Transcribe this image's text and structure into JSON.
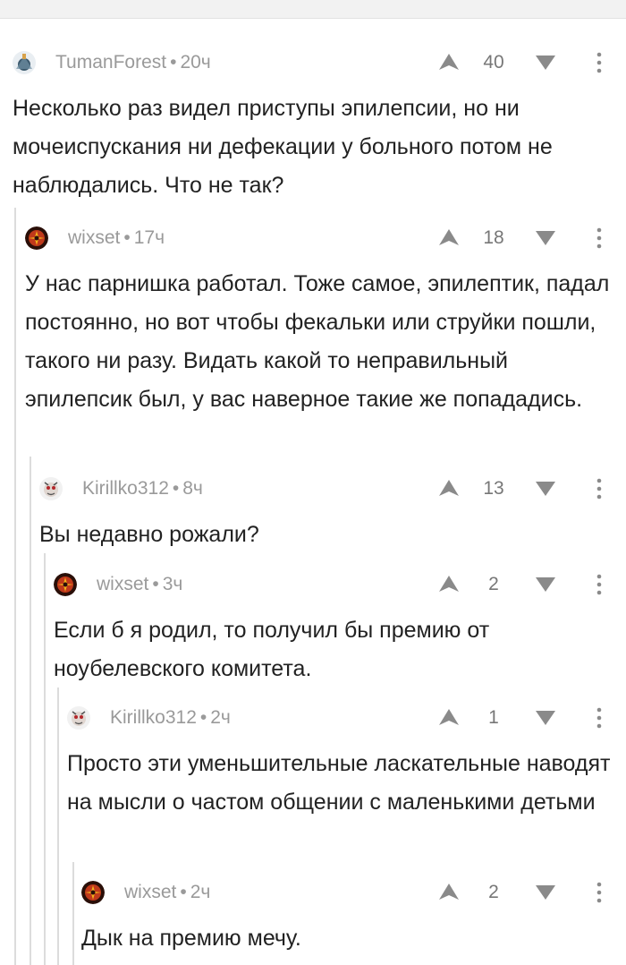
{
  "comments": [
    {
      "author": "TumanForest",
      "time": "20ч",
      "score": "40",
      "text": "Несколько раз видел приступы эпилепсии, но ни мочеиспускания ни дефекации у больного потом не наблюдались. Что не так?",
      "avatar": "tumanforest-avatar"
    },
    {
      "author": "wixset",
      "time": "17ч",
      "score": "18",
      "text": "У нас парнишка работал. Тоже самое, эпилептик, падал постоянно, но вот чтобы фекальки или струйки пошли, такого ни разу. Видать какой то неправильный эпилепсик был, у вас наверное такие же попададись.",
      "avatar": "wixset-avatar"
    },
    {
      "author": "Kirillko312",
      "time": "8ч",
      "score": "13",
      "text": "Вы недавно рожали?",
      "avatar": "kirillko312-avatar"
    },
    {
      "author": "wixset",
      "time": "3ч",
      "score": "2",
      "text": "Если б я родил, то получил бы премию от ноубелевского комитета.",
      "avatar": "wixset-avatar"
    },
    {
      "author": "Kirillko312",
      "time": "2ч",
      "score": "1",
      "text": "Просто эти уменьшительные ласкательные наводят на мысли о частом общении с маленькими детьми",
      "avatar": "kirillko312-avatar"
    },
    {
      "author": "wixset",
      "time": "2ч",
      "score": "2",
      "text": "Дык на премию мечу.",
      "avatar": "wixset-avatar"
    }
  ],
  "colors": {
    "meta": "#9a9a9a",
    "icon": "#8a8a8a",
    "thread_line": "#dcdcdc",
    "text": "#222222"
  }
}
